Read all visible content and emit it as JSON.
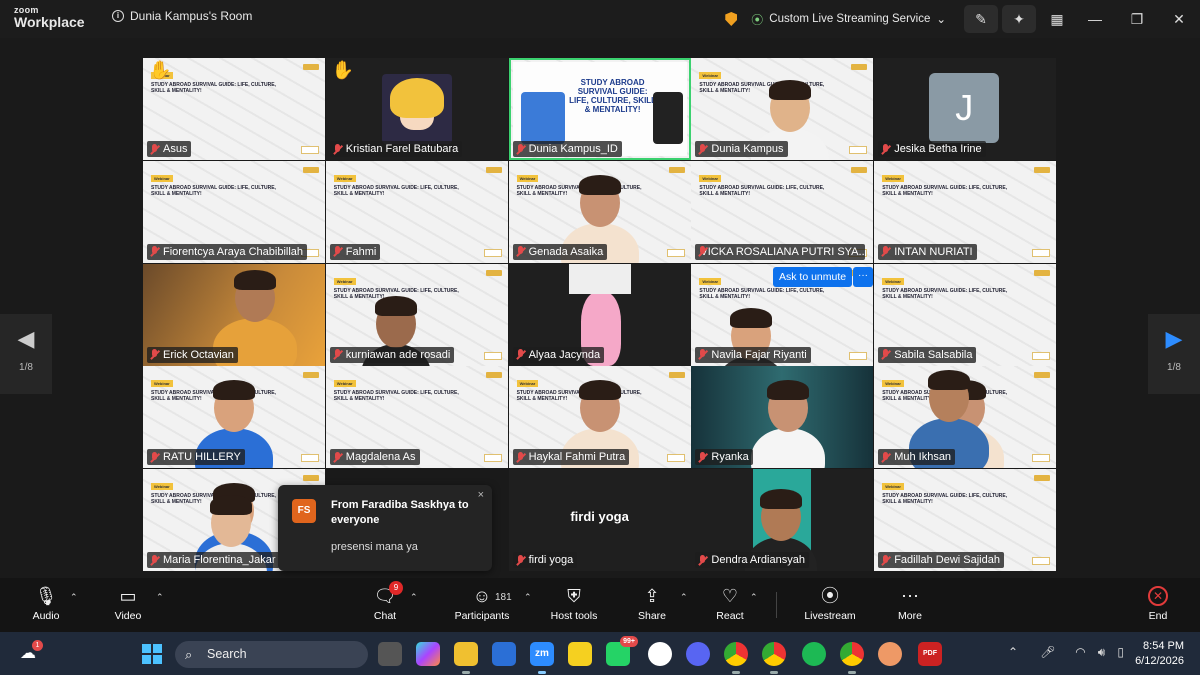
{
  "titlebar": {
    "logo_line1": "zoom",
    "logo_line2": "Workplace",
    "room_name": "Dunia Kampus's Room",
    "stream_label": "Custom Live Streaming Service",
    "icons": [
      "shield-icon",
      "signal-icon",
      "edit-icon",
      "sparkle-icon",
      "apps-grid-icon"
    ]
  },
  "gallery": {
    "page_left": "1/8",
    "page_right": "1/8",
    "ask_to_unmute": "Ask to unmute",
    "more_dots": "···",
    "center_name": "firdi yoga",
    "poster_title": "STUDY ABROAD SURVIVAL GUIDE: LIFE, CULTURE, SKILL & MENTALITY!",
    "banner_webinar": "Webinar",
    "banner_text": "STUDY ABROAD SURVIVAL GUIDE: LIFE, CULTURE, SKILL & MENTALITY!",
    "participants": [
      "Asus",
      "Kristian Farel Batubara",
      "Dunia Kampus_ID",
      "Dunia Kampus",
      "Jesika Betha Irine",
      "Fiorentcya Araya Chabibillah",
      "Fahmi",
      "Genada Asaika",
      "VICKA ROSALIANA PUTRI SYA...",
      "INTAN NURIATI",
      "Erick Octavian",
      "kurniawan ade rosadi",
      "Alyaa Jacynda",
      "Navila Fajar Riyanti",
      "Sabila Salsabila",
      "RATU HILLERY",
      "Magdalena As",
      "Haykal Fahmi Putra",
      "Ryanka",
      "Muh Ikhsan",
      "Maria Florentina_Jakar",
      "",
      "firdi yoga",
      "Dendra Ardiansyah",
      "Fadillah Dewi Sajidah"
    ],
    "avatar_letter": "J"
  },
  "chat_toast": {
    "initials": "FS",
    "from": "From Faradiba Saskhya to everyone",
    "message": "presensi mana ya",
    "close": "×"
  },
  "toolbar": {
    "audio": "Audio",
    "video": "Video",
    "chat": "Chat",
    "chat_badge": "9",
    "participants": "Participants",
    "participant_count": "181",
    "host_tools": "Host tools",
    "share": "Share",
    "react": "React",
    "livestream": "Livestream",
    "more": "More",
    "end": "End"
  },
  "taskbar": {
    "weather_badge": "1",
    "search_placeholder": "Search",
    "whatsapp_badge": "99+",
    "time": "8:54 PM",
    "date": "6/12/2026"
  }
}
